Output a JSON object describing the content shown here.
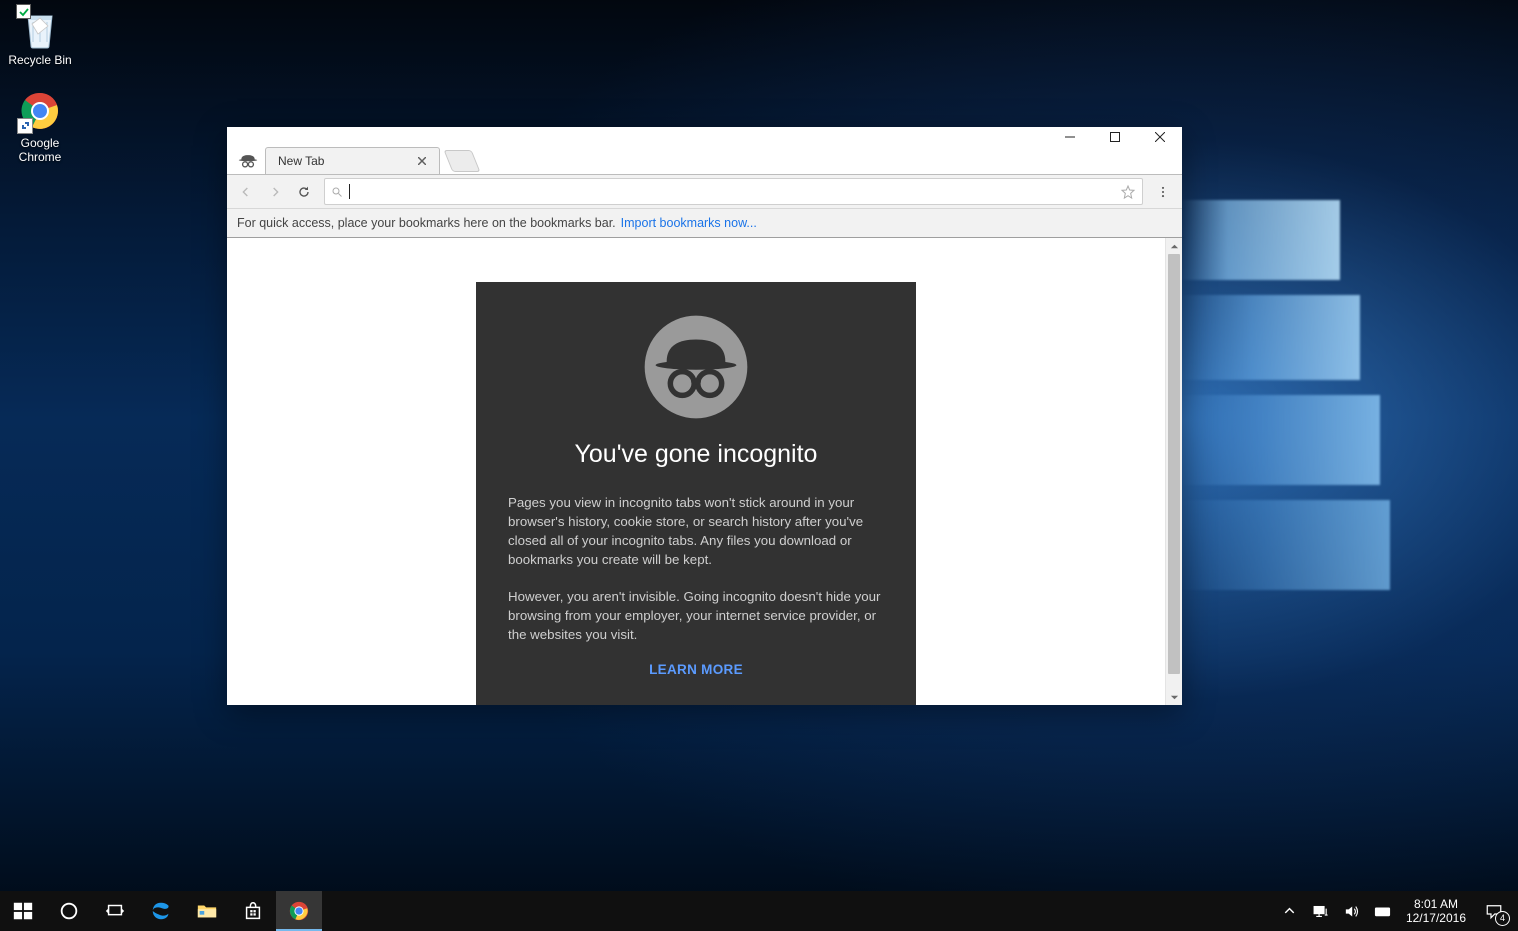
{
  "desktop": {
    "icons": [
      {
        "label": "Recycle Bin"
      },
      {
        "label": "Google Chrome"
      }
    ]
  },
  "chrome": {
    "tab": {
      "title": "New Tab"
    },
    "omnibox": {
      "value": ""
    },
    "bookmark_bar": {
      "prompt": "For quick access, place your bookmarks here on the bookmarks bar.",
      "link": "Import bookmarks now..."
    },
    "incognito": {
      "heading": "You've gone incognito",
      "p1": "Pages you view in incognito tabs won't stick around in your browser's history, cookie store, or search history after you've closed all of your incognito tabs. Any files you download or bookmarks you create will be kept.",
      "p2": "However, you aren't invisible. Going incognito doesn't hide your browsing from your employer, your internet service provider, or the websites you visit.",
      "learn_more": "LEARN MORE"
    }
  },
  "taskbar": {
    "time": "8:01 AM",
    "date": "12/17/2016",
    "notifications": "4"
  }
}
